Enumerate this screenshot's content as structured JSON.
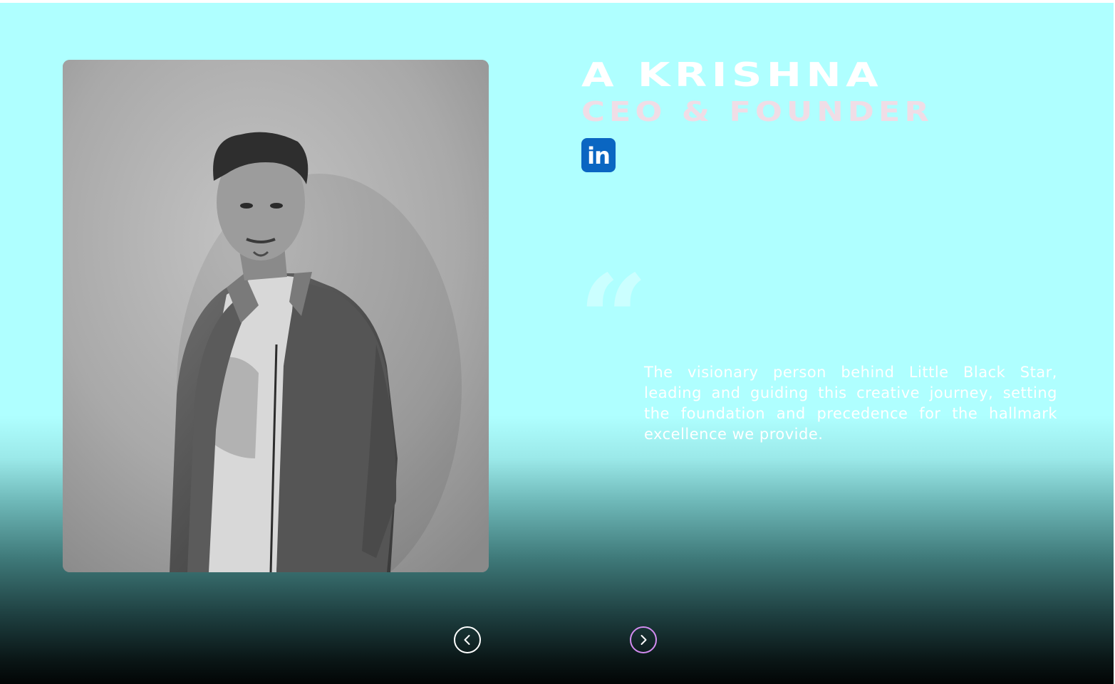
{
  "member": {
    "name": "A KRISHNA",
    "role": "CEO & FOUNDER",
    "bio": "The visionary person behind Little Black Star, leading and guiding this creative journey, setting the foundation and precedence for the hallmark excellence we provide."
  },
  "icons": {
    "linkedin": "linkedin-icon",
    "quote": "quote-icon",
    "prev": "chevron-left-icon",
    "next": "chevron-right-icon"
  },
  "social": {
    "linkedin_label": "in"
  },
  "quote_glyph": "“",
  "colors": {
    "background_top": "#afffff",
    "background_bottom": "#020505",
    "name": "#ffffff",
    "role": "#f0dde6",
    "linkedin": "#0a66c2",
    "next_button_accent": "#d38cf0"
  }
}
